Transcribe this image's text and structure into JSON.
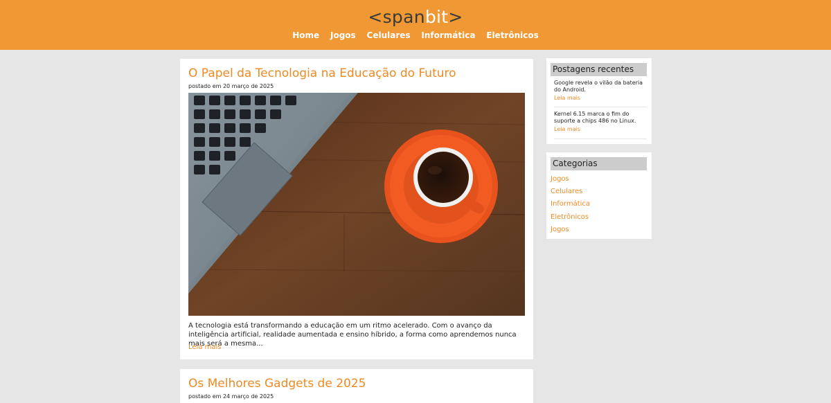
{
  "site": {
    "logo_open": "<",
    "logo_span": "span",
    "logo_bit": "bit",
    "logo_close": ">"
  },
  "nav": {
    "items": [
      "Home",
      "Jogos",
      "Celulares",
      "Informática",
      "Eletrônicos"
    ]
  },
  "posts": [
    {
      "title": "O Papel da Tecnologia na Educação do Futuro",
      "date": "postado em 20 março de 2025",
      "excerpt": "A tecnologia está transformando a educação em um ritmo acelerado. Com o avanço da inteligência artificial, realidade aumentada e ensino híbrido, a forma como aprendemos nunca mais será a mesma...",
      "read_more": "Leia mais"
    },
    {
      "title": "Os Melhores Gadgets de 2025",
      "date": "postado em 24 março de 2025"
    }
  ],
  "sidebar": {
    "recent_title": "Postagens recentes",
    "recent": [
      {
        "text": "Google revela o vilão da bateria do Android.",
        "read_more": "Leia mais"
      },
      {
        "text": "Kernel 6.15 marca o fim do suporte a chips 486 no Linux.",
        "read_more": "Leia mais"
      }
    ],
    "categories_title": "Categorias",
    "categories": [
      "Jogos",
      "Celulares",
      "Informática",
      "Eletrônicos",
      "Jogos"
    ]
  },
  "colors": {
    "accent": "#ee8a24",
    "header_bg": "#f09934",
    "page_bg": "#e6e6e6",
    "sidebar_head_bg": "#cccccc"
  }
}
